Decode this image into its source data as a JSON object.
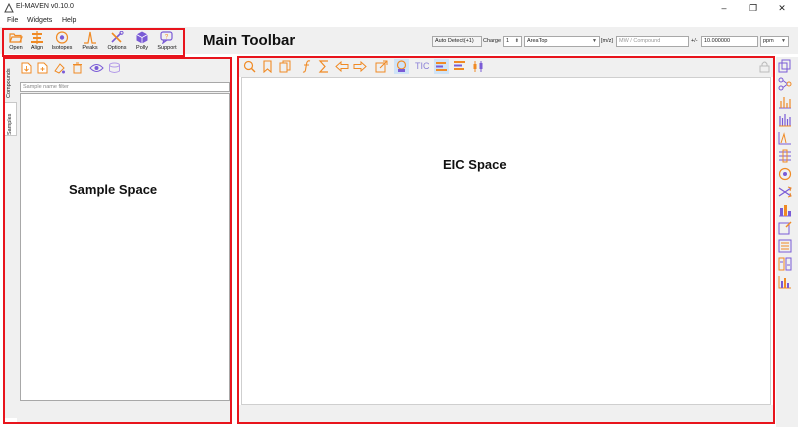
{
  "window": {
    "title": "El-MAVEN v0.10.0",
    "minimize_glyph": "–",
    "maximize_glyph": "❐",
    "close_glyph": "✕"
  },
  "menu": {
    "items": [
      "File",
      "Widgets",
      "Help"
    ]
  },
  "toolbar": {
    "buttons": [
      {
        "label": "Open",
        "icon": "folder-open-icon"
      },
      {
        "label": "Align",
        "icon": "align-icon"
      },
      {
        "label": "Isotopes",
        "icon": "isotopes-icon"
      },
      {
        "label": "Peaks",
        "icon": "peaks-icon"
      },
      {
        "label": "Options",
        "icon": "options-icon"
      },
      {
        "label": "Polly",
        "icon": "polly-icon"
      },
      {
        "label": "Support",
        "icon": "support-icon"
      }
    ]
  },
  "search_options": {
    "auto_detect_label": "Auto Detect(+1)",
    "charge_label": "Charge",
    "charge_value": "1",
    "quant_type": "AreaTop",
    "mz_label": "[m/z]",
    "mz_placeholder": "MW / Compound",
    "ppm_label": "+/-",
    "ppm_value": "10.000000",
    "ppm_unit": "ppm"
  },
  "sample_panel": {
    "tabs": [
      "Compounds",
      "Samples"
    ],
    "filter_placeholder": "Sample name filter"
  },
  "eic": {
    "tic_label": "TIC"
  },
  "annotations": {
    "main_toolbar": "Main Toolbar",
    "sample_space": "Sample Space",
    "eic_space": "EIC Space"
  },
  "colors": {
    "annotation_box": "#e8141c",
    "icon_orange": "#f08a24",
    "icon_purple": "#7a5bd6"
  }
}
